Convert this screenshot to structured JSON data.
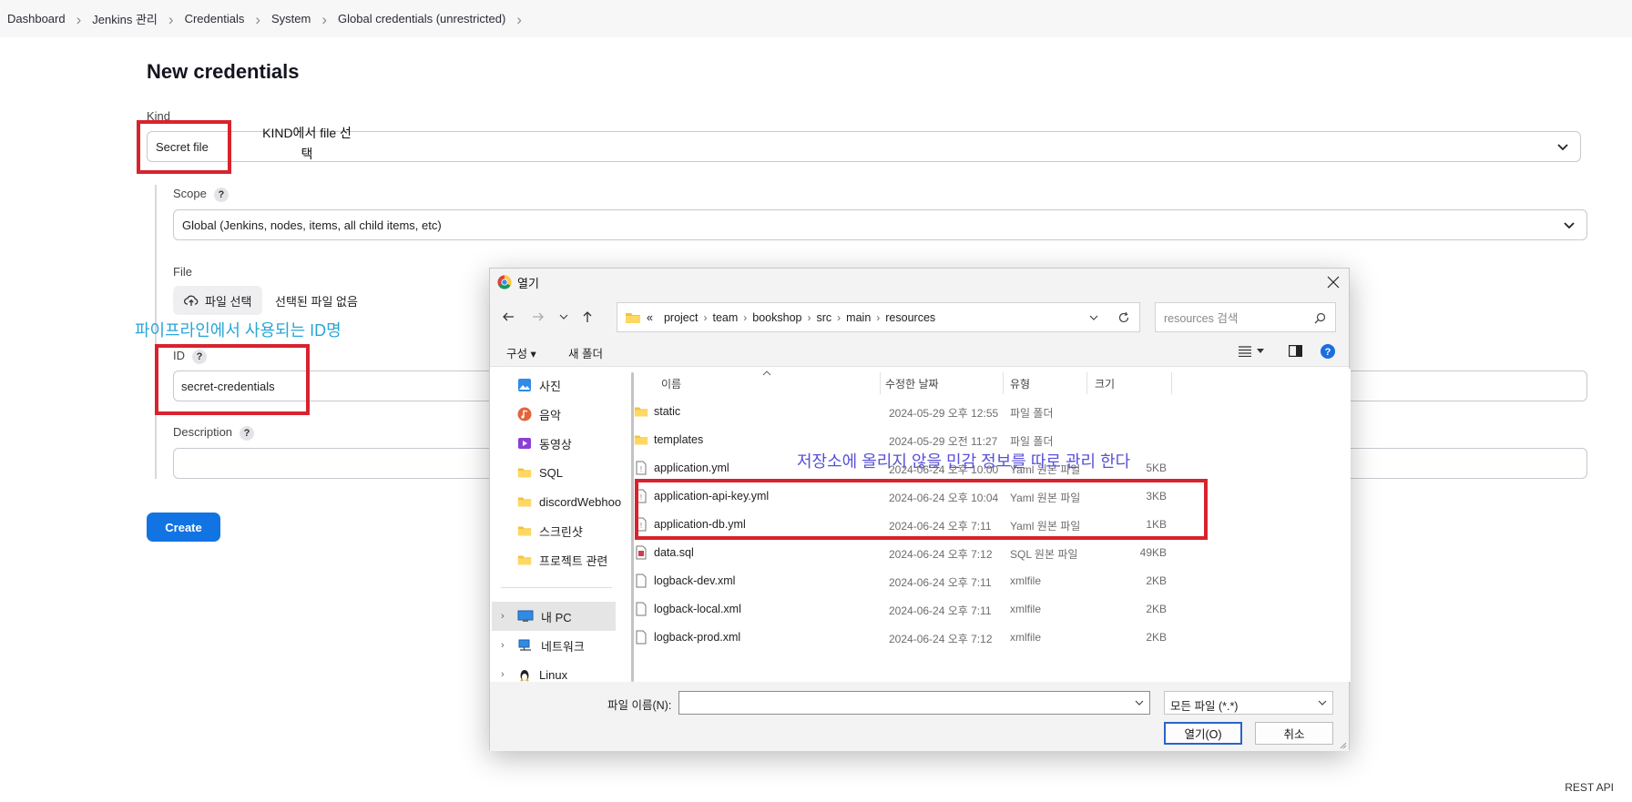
{
  "breadcrumb": [
    "Dashboard",
    "Jenkins 관리",
    "Credentials",
    "System",
    "Global credentials (unrestricted)"
  ],
  "page_title": "New credentials",
  "form": {
    "kind_label": "Kind",
    "kind_value": "Secret file",
    "scope_label": "Scope",
    "scope_value": "Global (Jenkins, nodes, items, all child items, etc)",
    "file_label": "File",
    "file_button": "파일 선택",
    "no_file_text": "선택된 파일 없음",
    "id_label": "ID",
    "id_value": "secret-credentials",
    "description_label": "Description",
    "description_value": "",
    "help": "?",
    "create_button": "Create"
  },
  "annotations": {
    "kind_note": "KIND에서 file 선택",
    "id_note": "파이프라인에서 사용되는 ID명",
    "files_note": "저장소에 올리지 않을 민감 정보를 따로 관리 한다"
  },
  "footer": {
    "rest_api": "REST API"
  },
  "dialog": {
    "title": "열기",
    "path_prefix": "«",
    "path": [
      "project",
      "team",
      "bookshop",
      "src",
      "main",
      "resources"
    ],
    "search_placeholder": "resources 검색",
    "toolbar": {
      "organize": "구성",
      "new_folder": "새 폴더"
    },
    "nav_items": [
      {
        "label": "사진",
        "icon": "pictures-icon",
        "pinned": true
      },
      {
        "label": "음악",
        "icon": "music-icon",
        "pinned": true
      },
      {
        "label": "동영상",
        "icon": "videos-icon",
        "pinned": true
      },
      {
        "label": "SQL",
        "icon": "folder-icon",
        "pinned": false
      },
      {
        "label": "discordWebhoo",
        "icon": "folder-icon",
        "pinned": false
      },
      {
        "label": "스크린샷",
        "icon": "folder-icon",
        "pinned": false
      },
      {
        "label": "프로젝트 관련",
        "icon": "folder-icon",
        "pinned": false
      },
      {
        "label": "내 PC",
        "icon": "pc-icon",
        "pinned": false
      },
      {
        "label": "네트워크",
        "icon": "network-icon",
        "pinned": false
      },
      {
        "label": "Linux",
        "icon": "linux-icon",
        "pinned": false
      }
    ],
    "columns": {
      "name": "이름",
      "date": "수정한 날짜",
      "type": "유형",
      "size": "크기"
    },
    "files": [
      {
        "name": "static",
        "date": "2024-05-29 오후 12:55",
        "type": "파일 폴더",
        "size": "",
        "icon": "folder-icon"
      },
      {
        "name": "templates",
        "date": "2024-05-29 오전 11:27",
        "type": "파일 폴더",
        "size": "",
        "icon": "folder-icon"
      },
      {
        "name": "application.yml",
        "date": "2024-06-24 오후 10:00",
        "type": "Yaml 원본 파일",
        "size": "5KB",
        "icon": "yaml-file-icon"
      },
      {
        "name": "application-api-key.yml",
        "date": "2024-06-24 오후 10:04",
        "type": "Yaml 원본 파일",
        "size": "3KB",
        "icon": "yaml-file-icon"
      },
      {
        "name": "application-db.yml",
        "date": "2024-06-24 오후 7:11",
        "type": "Yaml 원본 파일",
        "size": "1KB",
        "icon": "yaml-file-icon"
      },
      {
        "name": "data.sql",
        "date": "2024-06-24 오후 7:12",
        "type": "SQL 원본 파일",
        "size": "49KB",
        "icon": "sql-file-icon"
      },
      {
        "name": "logback-dev.xml",
        "date": "2024-06-24 오후 7:11",
        "type": "xmlfile",
        "size": "2KB",
        "icon": "file-icon"
      },
      {
        "name": "logback-local.xml",
        "date": "2024-06-24 오후 7:11",
        "type": "xmlfile",
        "size": "2KB",
        "icon": "file-icon"
      },
      {
        "name": "logback-prod.xml",
        "date": "2024-06-24 오후 7:12",
        "type": "xmlfile",
        "size": "2KB",
        "icon": "file-icon"
      }
    ],
    "filename_label": "파일 이름(N):",
    "filename_value": "",
    "filetype": "모든 파일 (*.*)",
    "open_button": "열기(O)",
    "cancel_button": "취소"
  },
  "colors": {
    "accent": "#1274e2",
    "annotation_red": "#d8232e",
    "annotation_blue": "#2aa6d6",
    "annotation_purple": "#5a50d8"
  }
}
